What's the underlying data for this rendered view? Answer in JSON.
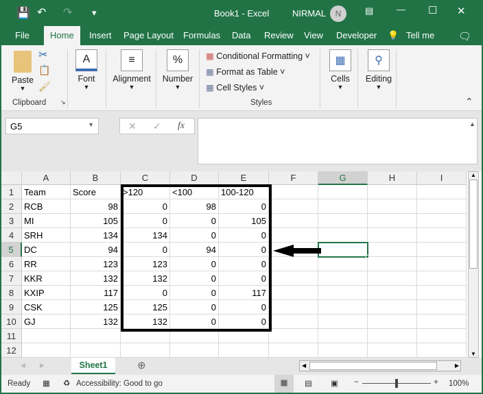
{
  "title": "Book1  -  Excel",
  "user": {
    "name": "NIRMAL",
    "initial": "N"
  },
  "tabs": [
    "File",
    "Home",
    "Insert",
    "Page Layout",
    "Formulas",
    "Data",
    "Review",
    "View",
    "Developer",
    "Tell me"
  ],
  "ribbon": {
    "paste": "Paste",
    "clipboard": "Clipboard",
    "font": "Font",
    "alignment": "Alignment",
    "number": "Number",
    "conditional": "Conditional Formatting",
    "format_table": "Format as Table",
    "cell_styles": "Cell Styles",
    "styles": "Styles",
    "cells": "Cells",
    "editing": "Editing"
  },
  "formula_bar": {
    "name_box": "G5",
    "fx": "fx",
    "value": ""
  },
  "columns": [
    "A",
    "B",
    "C",
    "D",
    "E",
    "F",
    "G",
    "H",
    "I"
  ],
  "rows": [
    [
      "Team",
      "Score",
      ">120",
      "<100",
      "100-120"
    ],
    [
      "RCB",
      "98",
      "0",
      "98",
      "0"
    ],
    [
      "MI",
      "105",
      "0",
      "0",
      "105"
    ],
    [
      "SRH",
      "134",
      "134",
      "0",
      "0"
    ],
    [
      "DC",
      "94",
      "0",
      "94",
      "0"
    ],
    [
      "RR",
      "123",
      "123",
      "0",
      "0"
    ],
    [
      "KKR",
      "132",
      "132",
      "0",
      "0"
    ],
    [
      "KXIP",
      "117",
      "0",
      "0",
      "117"
    ],
    [
      "CSK",
      "125",
      "125",
      "0",
      "0"
    ],
    [
      "GJ",
      "132",
      "132",
      "0",
      "0"
    ],
    [
      "",
      "",
      "",
      "",
      ""
    ],
    [
      "",
      "",
      "",
      "",
      ""
    ]
  ],
  "selected_cell": "G5",
  "sheet": "Sheet1",
  "status": {
    "ready": "Ready",
    "accessibility": "Accessibility: Good to go",
    "zoom": "100%"
  },
  "colors": {
    "accent": "#217346"
  }
}
